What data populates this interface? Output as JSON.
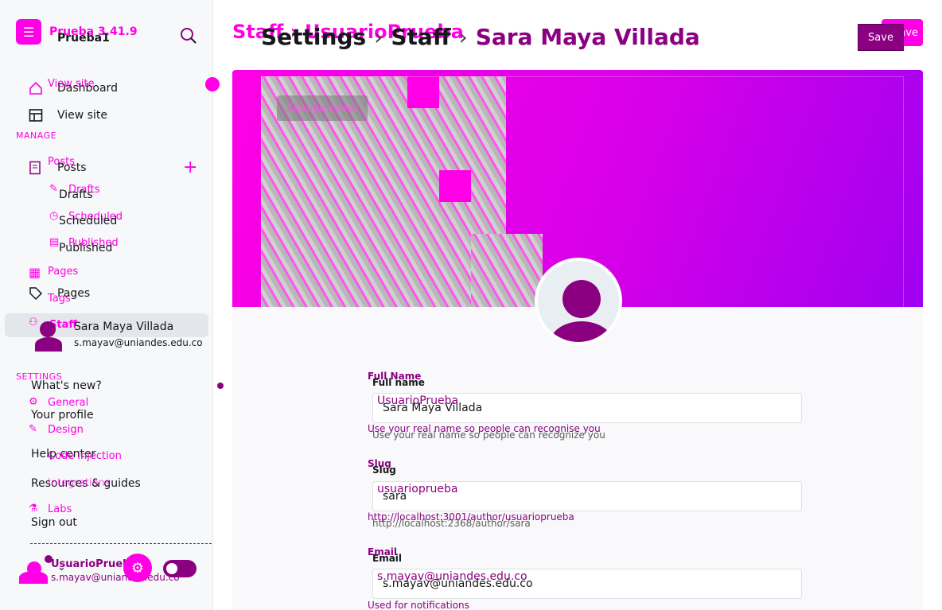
{
  "brand": {
    "version_label": "Prueba 3.41.9",
    "site_name": "Prueba1"
  },
  "sidebar": {
    "ghost_view_site": "View site",
    "dashboard": "Dashboard",
    "view_site": "View site",
    "manage_title": "MANAGE",
    "posts_ghost": "Posts",
    "posts": "Posts",
    "drafts_ghost": "Drafts",
    "drafts": "Drafts",
    "scheduled_ghost": "Scheduled",
    "scheduled": "Scheduled",
    "published_ghost": "Published",
    "published": "Published",
    "pages_ghost": "Pages",
    "pages": "Pages",
    "tags_ghost": "Tags",
    "staff_ghost": "Staff",
    "staff_name": "Sara Maya Villada",
    "staff_email": "s.mayav@uniandes.edu.co",
    "settings_title": "SETTINGS",
    "whats_new": "What's new?",
    "general": "General",
    "your_profile": "Your profile",
    "design": "Design",
    "help_center": "Help center",
    "code_injection": "Code injection",
    "integrations": "Integrations",
    "resources_guides": "Resources & guides",
    "labs": "Labs",
    "sign_out": "Sign out",
    "user_name": "UsuarioPrueba",
    "user_email": "s.mayav@uniandes.edu.co"
  },
  "header": {
    "ghost_crumb": "Staff › UsuarioPrueba",
    "crumb_settings": "Settings",
    "crumb_staff": "Staff",
    "crumb_user": "Sara Maya Villada",
    "sep": "›",
    "save_ghost": "Save",
    "save": "Save"
  },
  "cover": {
    "change_cover": "Change cover"
  },
  "form": {
    "full_name_label_ghost": "Full Name",
    "full_name_label": "Full name",
    "full_name_value_ghost": "UsuarioPrueba",
    "full_name_value": "Sara Maya Villada",
    "full_name_hint_ghost": "Use your real name so people can recognise you",
    "full_name_hint": "Use your real name so people can recognize you",
    "slug_label_ghost": "Slug",
    "slug_label": "Slug",
    "slug_value_ghost": "usuarioprueba",
    "slug_value": "sara",
    "slug_hint_ghost": "http://localhost:3001/author/usuarioprueba",
    "slug_hint": "http://localhost:2368/author/sara",
    "email_label_ghost": "Email",
    "email_label": "Email",
    "email_value_ghost": "s.mayav@uniandes.edu.co",
    "email_value": "s.mayav@uniandes.edu.co",
    "email_hint": "Used for notifications"
  },
  "colors": {
    "accent": "#ff00e6",
    "dark_accent": "#8b0080"
  }
}
